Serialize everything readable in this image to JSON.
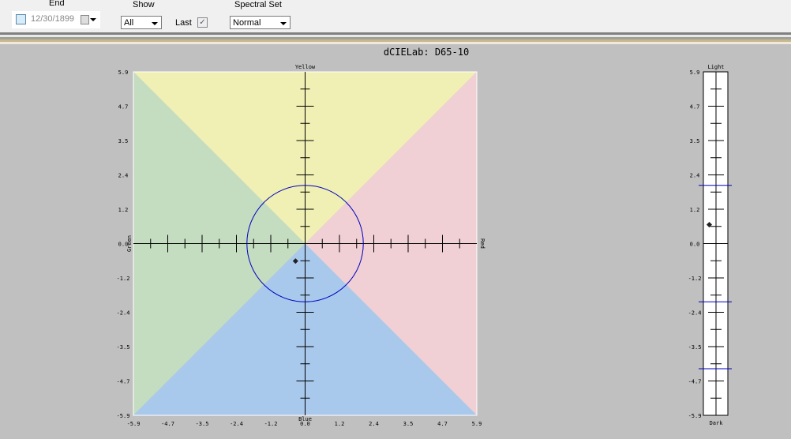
{
  "toolbar": {
    "end_label": "End",
    "end_date": "12/30/1899",
    "show_label": "Show",
    "show_value": "All",
    "last_label": "Last",
    "last_checked": true,
    "spectral_label": "Spectral Set",
    "spectral_value": "Normal"
  },
  "chart_data": [
    {
      "type": "scatter",
      "title": "dCIELab: D65-10",
      "axis_labels": {
        "top": "Yellow",
        "bottom": "Blue",
        "left": "Green",
        "right": "Red"
      },
      "xlim": [
        -5.9,
        5.9
      ],
      "ylim": [
        -5.9,
        5.9
      ],
      "tick_labels": [
        "-5.9",
        "-4.7",
        "-3.5",
        "-2.4",
        "-1.2",
        "0.0",
        "1.2",
        "2.4",
        "3.5",
        "4.7",
        "5.9"
      ],
      "tolerance_circle_radius": 2.0,
      "points": [
        {
          "da": -0.33,
          "db": -0.6
        }
      ],
      "region_colors": {
        "yellow": "#f0f0b4",
        "red": "#f0d0d4",
        "green": "#c4dcc0",
        "blue": "#a8c8ec"
      },
      "tolerance_color": "#0000c0"
    },
    {
      "type": "scatter",
      "axis_labels": {
        "top": "Light",
        "bottom": "Dark"
      },
      "ylim": [
        -5.9,
        5.9
      ],
      "tick_labels": [
        "-5.9",
        "-4.7",
        "-3.5",
        "-2.4",
        "-1.2",
        "0.0",
        "1.2",
        "2.4",
        "3.5",
        "4.7",
        "5.9"
      ],
      "tolerance_lines": [
        2.0,
        -2.0,
        -4.3
      ],
      "points": [
        {
          "dL": 0.65
        }
      ]
    }
  ]
}
